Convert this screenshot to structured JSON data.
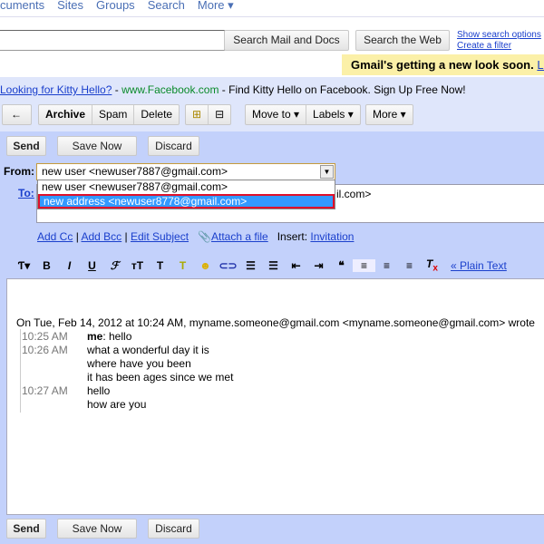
{
  "topnav": [
    "cuments",
    "Sites",
    "Groups",
    "Search",
    "More ▾"
  ],
  "search": {
    "value": "",
    "mail_button": "Search Mail and Docs",
    "web_button": "Search the Web",
    "show_options": "Show search options",
    "create_filter": "Create a filter"
  },
  "notice": {
    "text": "Gmail's getting a new look soon.",
    "link": "Le"
  },
  "ad": {
    "title": "Looking for Kitty Hello?",
    "sep1": " - ",
    "site": "www.Facebook.com",
    "text": " - Find Kitty Hello on Facebook. Sign Up Free Now!"
  },
  "toolbar": {
    "back": "←",
    "archive": "Archive",
    "spam": "Spam",
    "delete": "Delete",
    "move_to": "Move to ▾",
    "labels": "Labels ▾",
    "more": "More ▾"
  },
  "compose": {
    "send": "Send",
    "save_now": "Save Now",
    "discard": "Discard",
    "from_label": "From:",
    "from_value": "new user <newuser7887@gmail.com>",
    "from_options": [
      "new user <newuser7887@gmail.com>",
      "new address <newuser8778@gmail.com>"
    ],
    "to_label": "To:",
    "to_value_tail": "il.com>",
    "add_cc": "Add Cc",
    "add_bcc": "Add Bcc",
    "edit_subject": "Edit Subject",
    "attach": "Attach a file",
    "insert_label": "Insert:",
    "invitation": "Invitation",
    "plain_text": "« Plain Text"
  },
  "accent": {
    "highlight": "#3399ff",
    "red_outline": "#e0102a",
    "compose_bg": "#c3d1fb"
  },
  "message": {
    "header": "On Tue, Feb 14, 2012 at 10:24 AM, myname.someone@gmail.com <myname.someone@gmail.com> wrote",
    "lines": [
      {
        "time": "10:25 AM",
        "sender": "me",
        "text": ": hello"
      },
      {
        "time": "10:26 AM",
        "text": "what a wonderful day it is"
      },
      {
        "time": "",
        "text": "where have you been"
      },
      {
        "time": "",
        "text": "it has been ages since we met"
      },
      {
        "time": "10:27 AM",
        "text": "hello"
      },
      {
        "time": "",
        "text": "how are you"
      }
    ]
  }
}
